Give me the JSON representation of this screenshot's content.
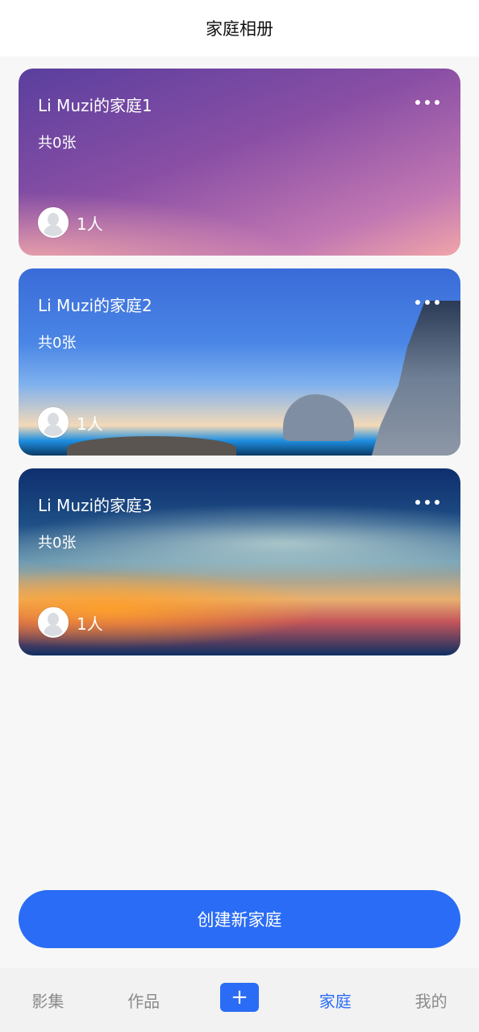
{
  "header": {
    "title": "家庭相册"
  },
  "cards": [
    {
      "name": "Li Muzi的家庭1",
      "count": "共0张",
      "members": "1人"
    },
    {
      "name": "Li Muzi的家庭2",
      "count": "共0张",
      "members": "1人"
    },
    {
      "name": "Li Muzi的家庭3",
      "count": "共0张",
      "members": "1人"
    }
  ],
  "create_button": {
    "label": "创建新家庭"
  },
  "tabs": [
    {
      "label": "影集"
    },
    {
      "label": "作品"
    },
    {
      "label": "+"
    },
    {
      "label": "家庭"
    },
    {
      "label": "我的"
    }
  ],
  "active_tab": "家庭",
  "colors": {
    "accent": "#2a6cf5",
    "background": "#f7f7f7"
  }
}
